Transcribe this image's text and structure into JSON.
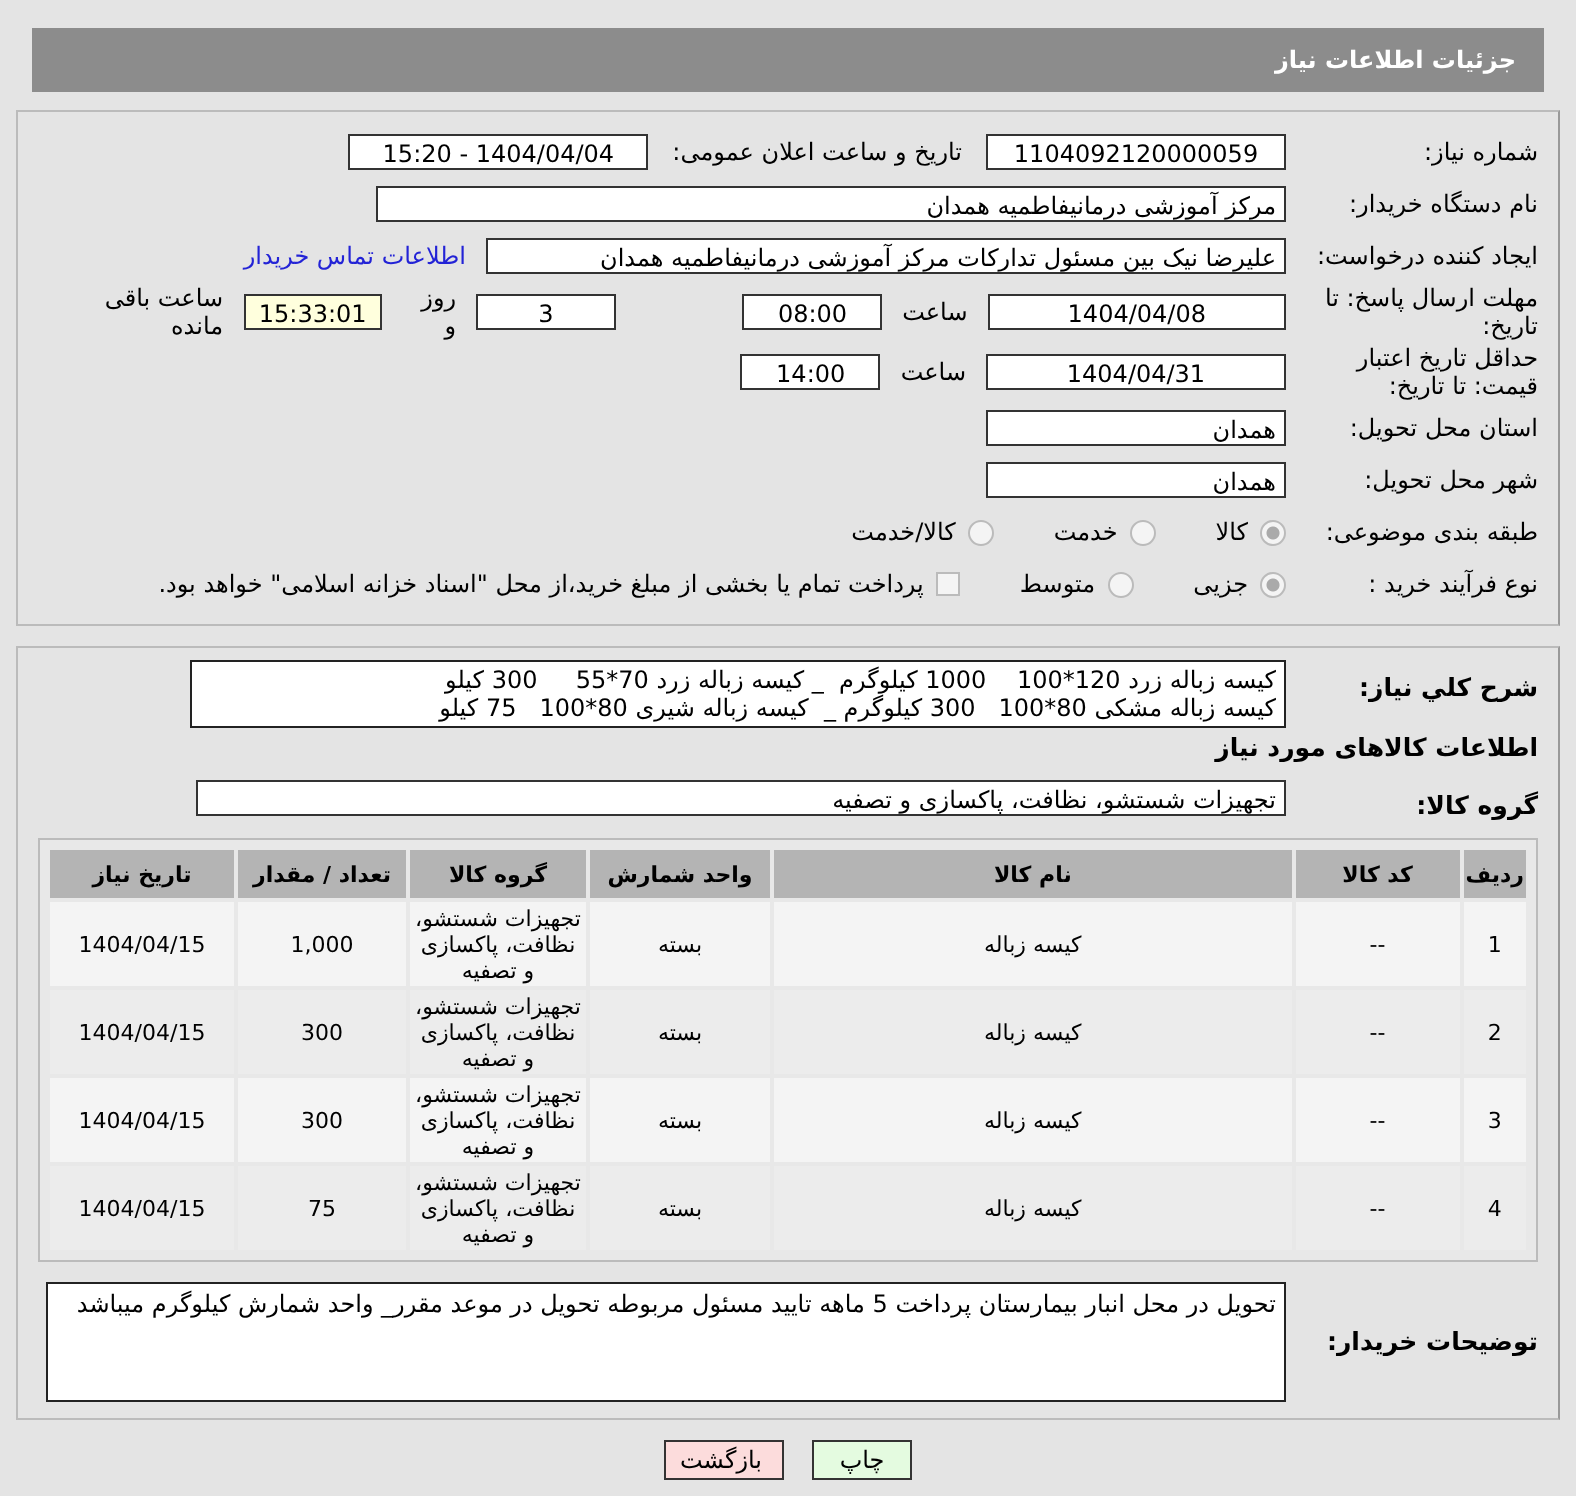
{
  "header": {
    "title": "جزئیات اطلاعات نیاز"
  },
  "details": {
    "need_number_label": "شماره نیاز:",
    "need_number": "1104092120000059",
    "announce_label": "تاریخ و ساعت اعلان عمومی:",
    "announce_value": "1404/04/04 - 15:20",
    "buyer_label": "نام دستگاه خریدار:",
    "buyer": "مرکز آموزشی درمانیفاطمیه همدان",
    "requester_label": "ایجاد کننده درخواست:",
    "requester": "علیرضا نیک بین مسئول تدارکات مرکز آموزشی درمانیفاطمیه همدان",
    "contact_link": "اطلاعات تماس خریدار",
    "deadline_label": "مهلت ارسال پاسخ: تا تاریخ:",
    "deadline_date": "1404/04/08",
    "time_label_1": "ساعت",
    "deadline_time": "08:00",
    "days": "3",
    "days_label": "روز و",
    "remaining": "15:33:01",
    "remaining_label": "ساعت باقی مانده",
    "validity_label": "حداقل تاریخ اعتبار قیمت: تا تاریخ:",
    "validity_date": "1404/04/31",
    "time_label_2": "ساعت",
    "validity_time": "14:00",
    "province_label": "استان محل تحویل:",
    "province": "همدان",
    "city_label": "شهر محل تحویل:",
    "city": "همدان",
    "category_label": "طبقه بندی موضوعی:",
    "category_options": [
      {
        "label": "کالا",
        "selected": true
      },
      {
        "label": "خدمت",
        "selected": false
      },
      {
        "label": "کالا/خدمت",
        "selected": false
      }
    ],
    "purchase_label": "نوع فرآیند خرید :",
    "purchase_options": [
      {
        "label": "جزیی",
        "selected": true
      },
      {
        "label": "متوسط",
        "selected": false
      }
    ],
    "treasury_payment": {
      "label": "پرداخت تمام یا بخشی از مبلغ خرید،از محل \"اسناد خزانه اسلامی\" خواهد بود.",
      "checked": false
    }
  },
  "description": {
    "label": "شرح کلي نياز:",
    "lines": [
      "کیسه زباله زرد 120*100    1000 کیلوگرم  _ کیسه زباله زرد 70*55     300 کیلو",
      "کیسه زباله مشکی 80*100   300 کیلوگرم _  کیسه زباله شیری 80*100   75 کیلو"
    ]
  },
  "items_title": "اطلاعات کالاهای مورد نیاز",
  "goods_group": {
    "label": "گروه کالا:",
    "value": "تجهیزات شستشو، نظافت، پاکسازی و تصفیه"
  },
  "table": {
    "columns": [
      "ردیف",
      "کد کالا",
      "نام کالا",
      "واحد شمارش",
      "گروه کالا",
      "تعداد / مقدار",
      "تاریخ نیاز"
    ],
    "rows": [
      [
        "1",
        "--",
        "کیسه زباله",
        "بسته",
        "تجهیزات شستشو، نظافت، پاکسازی و تصفیه",
        "1,000",
        "1404/04/15"
      ],
      [
        "2",
        "--",
        "کیسه زباله",
        "بسته",
        "تجهیزات شستشو، نظافت، پاکسازی و تصفیه",
        "300",
        "1404/04/15"
      ],
      [
        "3",
        "--",
        "کیسه زباله",
        "بسته",
        "تجهیزات شستشو، نظافت، پاکسازی و تصفیه",
        "300",
        "1404/04/15"
      ],
      [
        "4",
        "--",
        "کیسه زباله",
        "بسته",
        "تجهیزات شستشو، نظافت، پاکسازی و تصفیه",
        "75",
        "1404/04/15"
      ]
    ]
  },
  "buyer_notes": {
    "label": "توضیحات خریدار:",
    "text": "تحویل در محل انبار بیمارستان پرداخت 5 ماهه تایید مسئول مربوطه تحویل در موعد مقرر_ واحد شمارش کیلوگرم میباشد"
  },
  "buttons": [
    {
      "label": "چاپ",
      "kind": "print"
    },
    {
      "label": "بازگشت",
      "kind": "back"
    }
  ]
}
